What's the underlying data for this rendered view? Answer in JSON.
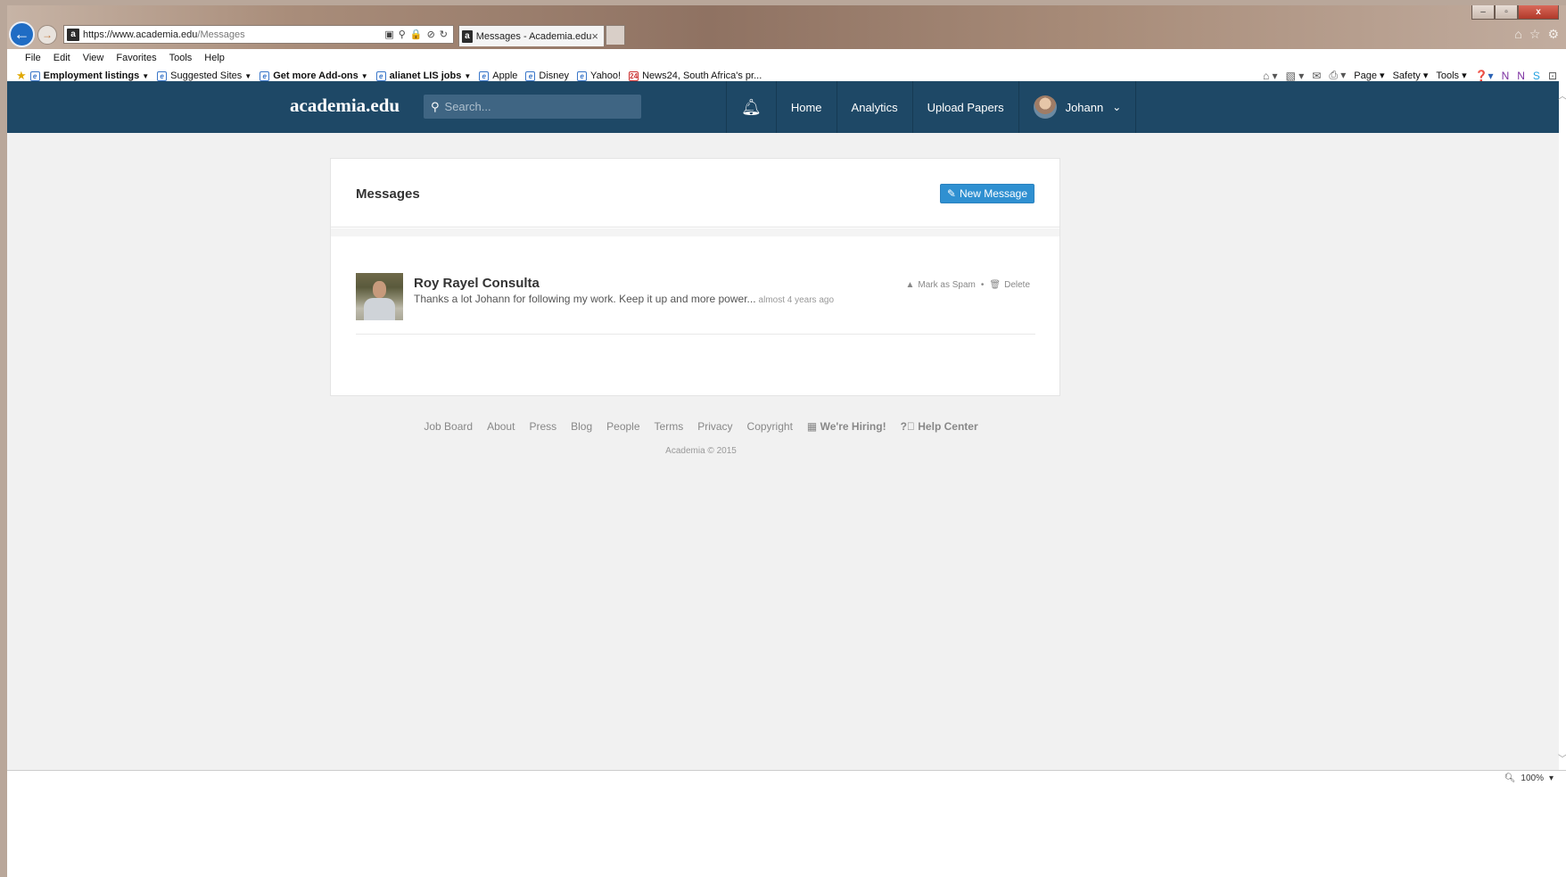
{
  "browser": {
    "url_host": "https://www.academia.edu",
    "url_path": "/Messages",
    "tab_title": "Messages - Academia.edu",
    "tab_close": "×",
    "window_controls": [
      "–",
      "▫",
      "x"
    ],
    "menu": [
      "File",
      "Edit",
      "View",
      "Favorites",
      "Tools",
      "Help"
    ],
    "favorites": [
      {
        "label": "Employment listings",
        "bold": true,
        "caret": true
      },
      {
        "label": "Suggested Sites",
        "bold": false,
        "caret": true
      },
      {
        "label": "Get more Add-ons",
        "bold": true,
        "caret": true
      },
      {
        "label": "alianet LIS jobs",
        "bold": true,
        "caret": true
      },
      {
        "label": "Apple",
        "bold": false,
        "caret": false
      },
      {
        "label": "Disney",
        "bold": false,
        "caret": false
      },
      {
        "label": "Yahoo!",
        "bold": false,
        "caret": false
      },
      {
        "label": "News24, South Africa's pr...",
        "bold": false,
        "caret": false
      }
    ],
    "command_bar": {
      "page": "Page",
      "safety": "Safety",
      "tools": "Tools"
    },
    "zoom": "100%"
  },
  "header": {
    "logo": "academia.edu",
    "search_placeholder": "Search...",
    "nav": {
      "home": "Home",
      "analytics": "Analytics",
      "upload": "Upload Papers",
      "user": "Johann"
    }
  },
  "messages": {
    "title": "Messages",
    "new_message_label": "New Message",
    "items": [
      {
        "sender": "Roy Rayel Consulta",
        "preview": "Thanks a lot Johann for following my work. Keep it up and more power...",
        "time": "almost 4 years ago",
        "spam_label": "Mark as Spam",
        "separator": "•",
        "delete_label": "Delete"
      }
    ]
  },
  "footer": {
    "links": [
      "Job Board",
      "About",
      "Press",
      "Blog",
      "People",
      "Terms",
      "Privacy",
      "Copyright"
    ],
    "hiring": "We're Hiring!",
    "help": "Help Center",
    "copyright": "Academia © 2015"
  },
  "colors": {
    "header_bg": "#1e4866",
    "accent_button": "#2f90d1",
    "page_bg": "#f1f1f1"
  }
}
